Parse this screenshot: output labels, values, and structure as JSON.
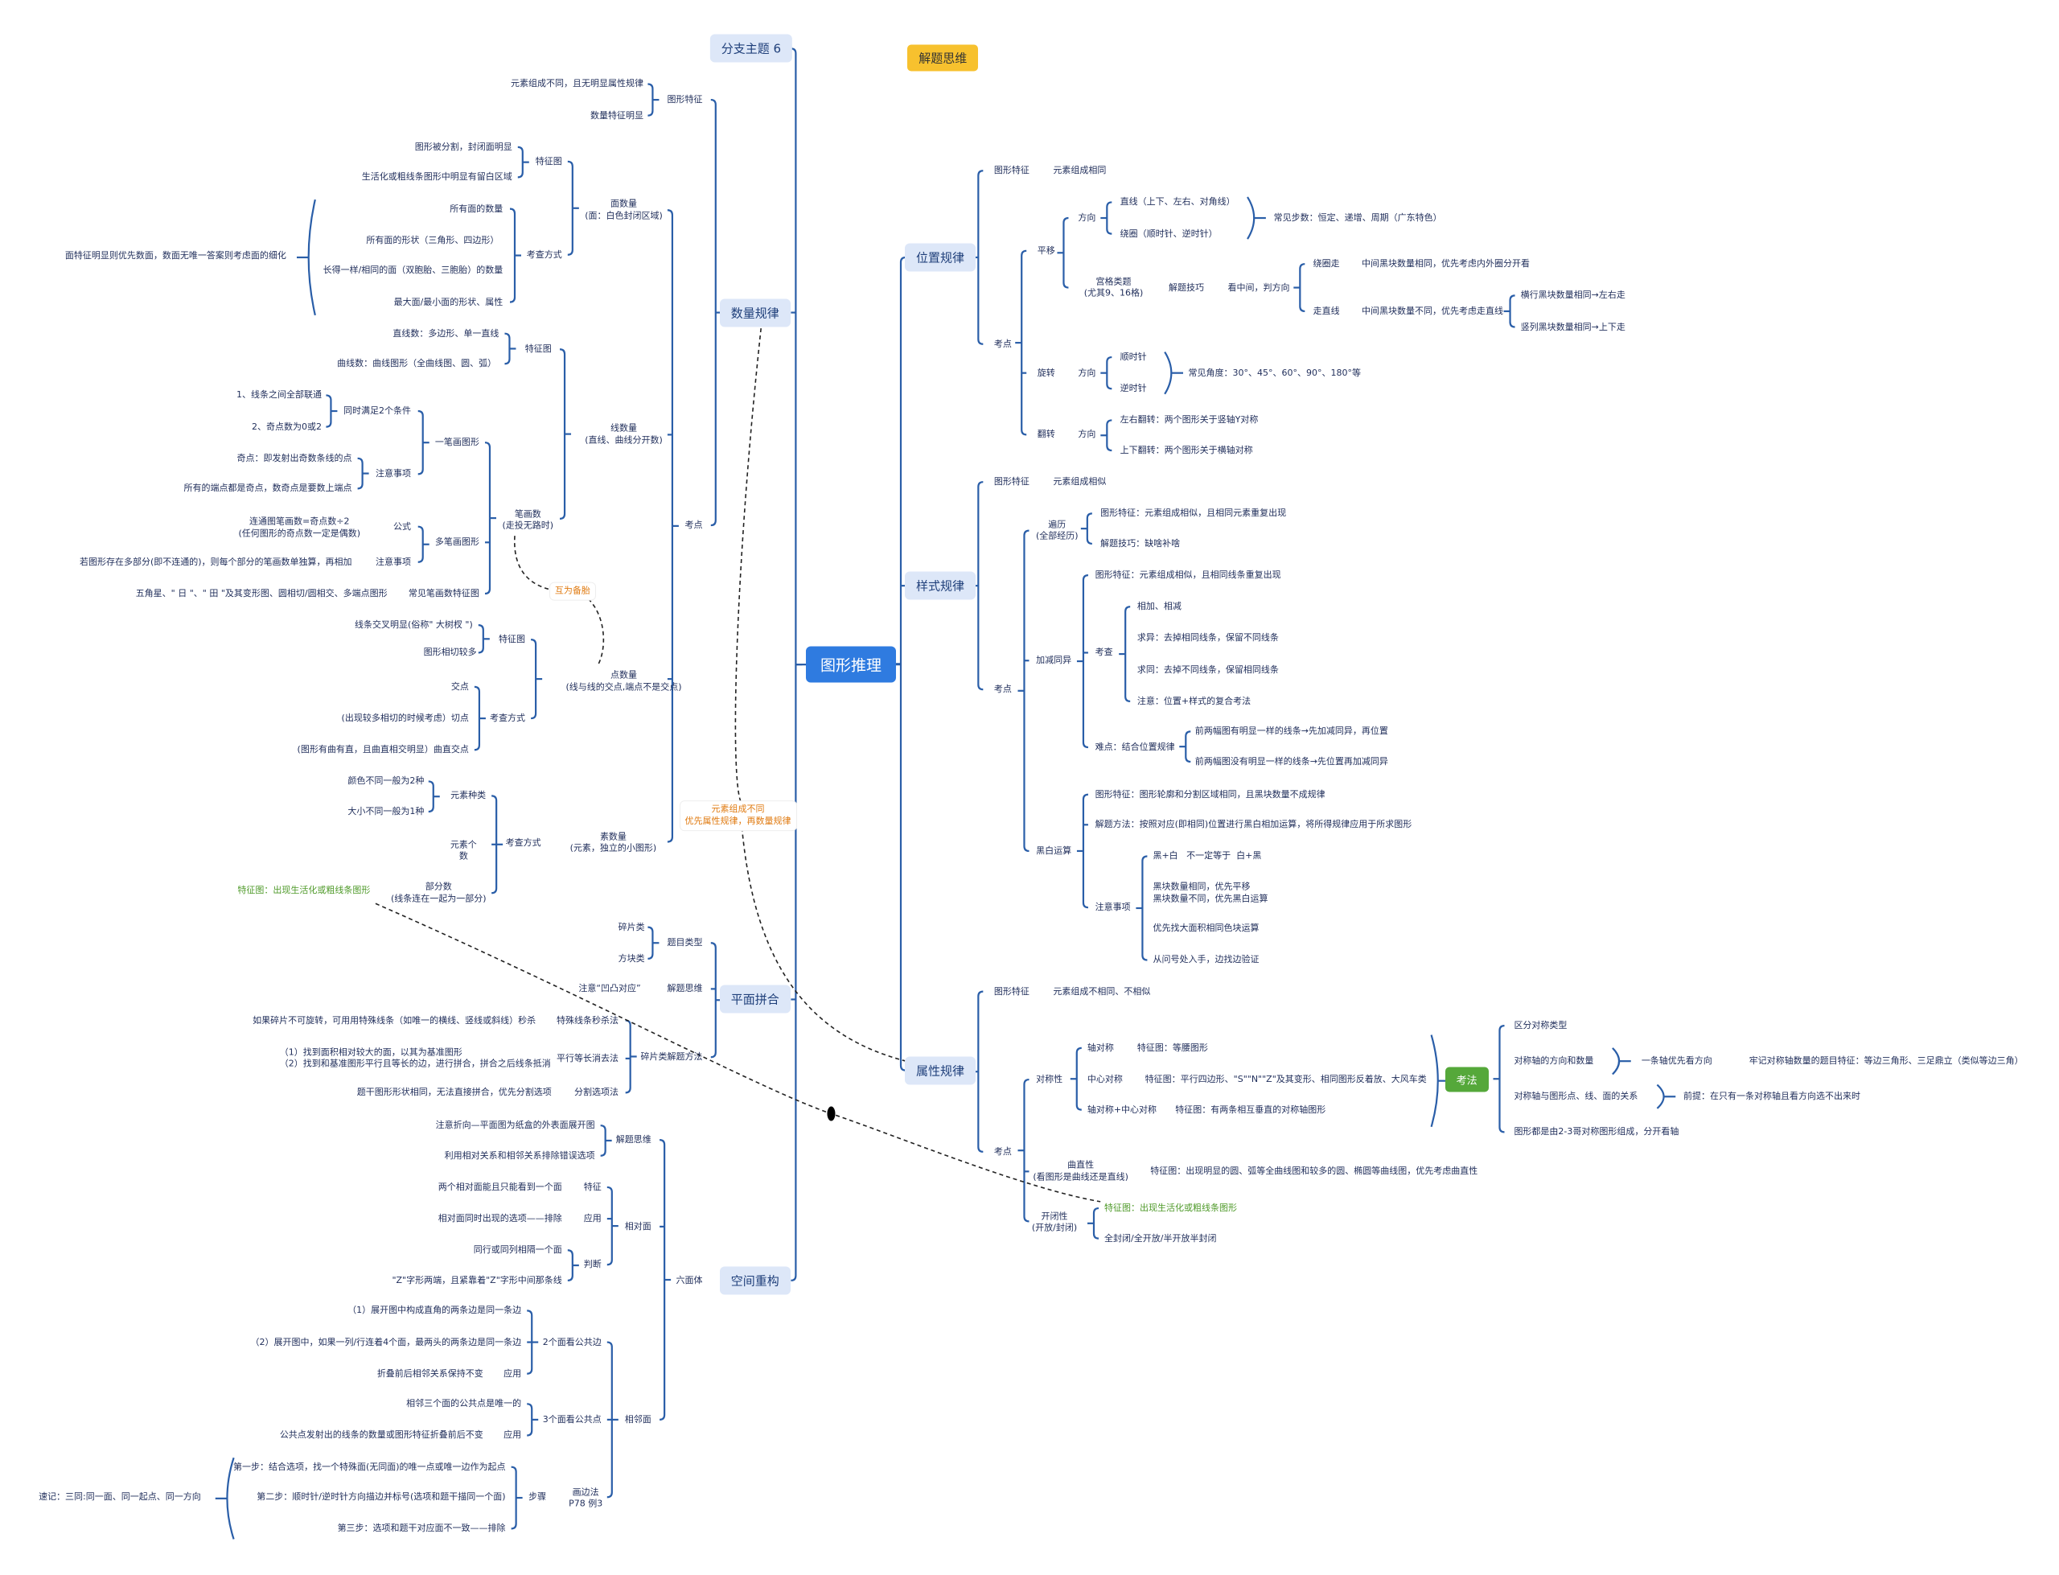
{
  "center": "图形推理",
  "tag": "解题思维",
  "branches": {
    "branch6": "分支主题 6",
    "quantity": "数量规律",
    "plane": "平面拼合",
    "space": "空间重构",
    "position": "位置规律",
    "style": "样式规律",
    "attribute": "属性规律"
  },
  "notes": {
    "backup": "互为备胎",
    "priority": "元素组成不同\n优先属性规律，再数量规律",
    "kaofa": "考法"
  },
  "colors": {
    "line": "#2a5ea8",
    "center": "#2f7be0",
    "branch_bg": "#dde7f8",
    "tag": "#f7c12e",
    "green": "#55a83a",
    "note_text": "#e07b12"
  },
  "quantity": [
    "元素组成不同，且无明显属性规律",
    "数量特征明显",
    "图形特征",
    "图形被分割，封闭面明显",
    "生活化或粗线条图形中明显有留白区域",
    "特征图",
    "所有面的数量",
    "所有面的形状（三角形、四边形）",
    "长得一样/相同的面（双胞胎、三胞胎）的数量",
    "最大面/最小面的形状、属性",
    "考查方式",
    "面数量\n(面：白色封闭区域)",
    "面特征明显则优先数面，数面无唯一答案则考虑面的细化",
    "考点",
    "直线数：多边形、单一直线",
    "曲线数：曲线图形（全曲线图、圆、弧）",
    "特征图",
    "线数量\n(直线、曲线分开数)",
    "1、线条之间全部联通",
    "2、奇点数为0或2",
    "同时满足2个条件",
    "奇点：即发射出奇数条线的点",
    "所有的端点都是奇点，数奇点是要数上端点",
    "注意事项",
    "一笔画图形",
    "连通图笔画数=奇点数÷2\n(任何图形的奇点数一定是偶数)",
    "公式",
    "若图形存在多部分(即不连通的)，则每个部分的笔画数单独算，再相加",
    "注意事项",
    "多笔画图形",
    "五角星、\" 日 \"、\" 田 \"及其变形图、圆相切/圆相交、多端点图形",
    "常见笔画数特征图",
    "笔画数\n(走投无路时)",
    "线条交叉明显(俗称\" 大树杈 \")",
    "图形相切较多",
    "特征图",
    "交点",
    "(出现较多相切的时候考虑）切点",
    "(图形有曲有直，且曲直相交明显）曲直交点",
    "考查方式",
    "点数量\n(线与线的交点,端点不是交点)",
    "颜色不同一般为2种",
    "大小不同一般为1种",
    "元素种类",
    "元素个\n数",
    "考查方式",
    "素数量\n(元素，独立的小图形)",
    "部分数\n(线条连在一起为一部分)",
    "特征图：出现生活化或粗线条图形"
  ],
  "plane": [
    "碎片类",
    "方块类",
    "题目类型",
    "注意“凹凸对应”",
    "解题思维",
    "如果碎片不可旋转，可用用特殊线条（如唯一的横线、竖线或斜线）秒杀",
    "特殊线条秒杀法",
    "（1）找到面积相对较大的面，以其为基准图形\n（2）找到和基准图形平行且等长的边，进行拼合，拼合之后线条抵消",
    "平行等长消去法",
    "题干图形形状相同，无法直接拼合，优先分割选项",
    "分割选项法",
    "碎片类解题方法"
  ],
  "space": [
    "注意折向—平面图为纸盒的外表面展开图",
    "利用相对关系和相邻关系排除错误选项",
    "解题思维",
    "两个相对面能且只能看到一个面",
    "特征",
    "相对面同时出现的选项——排除",
    "应用",
    "同行或同列相隔一个面",
    "\"Z\"字形两端，且紧靠着\"Z\"字形中间那条线",
    "判断",
    "相对面",
    "（1）展开图中构成直角的两条边是同一条边",
    "（2）展开图中，如果一列/行连着4个面，最两头的两条边是同一条边",
    "折叠前后相邻关系保持不变",
    "应用",
    "2个面看公共边",
    "相邻三个面的公共点是唯一的",
    "公共点发射出的线条的数量或图形特征折叠前后不变",
    "应用",
    "3个面看公共点",
    "第一步：结合选项，找一个特殊面(无同面)的唯一点或唯一边作为起点",
    "第二步：顺时针/逆时针方向描边并标号(选项和题干描同一个面)",
    "第三步：选项和题干对应面不一致——排除",
    "步骤",
    "画边法\nP78 例3",
    "速记：三同:同一面、同一起点、同一方向",
    "六面体",
    "相邻面"
  ],
  "position": [
    "图形特征",
    "元素组成相同",
    "考点",
    "平移",
    "方向",
    "直线（上下、左右、对角线）",
    "绕圈（顺时针、逆时针）",
    "常见步数：恒定、递增、周期（广东特色）",
    "宫格类题\n(尤其9、16格)",
    "解题技巧",
    "看中间，判方向",
    "绕圈走",
    "中间黑块数量相同，优先考虑内外圈分开看",
    "走直线",
    "中间黑块数量不同，优先考虑走直线",
    "横行黑块数量相同→左右走",
    "竖列黑块数量相同→上下走",
    "旋转",
    "方向",
    "顺时针",
    "逆时针",
    "常见角度：30°、45°、60°、90°、180°等",
    "翻转",
    "方向",
    "左右翻转：两个图形关于竖轴Y对称",
    "上下翻转：两个图形关于横轴对称"
  ],
  "style": [
    "图形特征",
    "元素组成相似",
    "考点",
    "遍历\n(全部经历)",
    "图形特征：元素组成相似，且相同元素重复出现",
    "解题技巧：缺啥补啥",
    "加减同异",
    "图形特征：元素组成相似，且相同线条重复出现",
    "考查",
    "相加、相减",
    "求异：去掉相同线条，保留不同线条",
    "求同：去掉不同线条，保留相同线条",
    "注意：位置+样式的复合考法",
    "难点：结合位置规律",
    "前两幅图有明显一样的线条→先加减同异，再位置",
    "前两幅图没有明显一样的线条→先位置再加减同异",
    "黑白运算",
    "图形特征：图形轮廓和分割区域相同，且黑块数量不成规律",
    "解题方法：按照对应(即相同)位置进行黑白相加运算，将所得规律应用于所求图形",
    "注意事项",
    "黑+白   不一定等于  白+黑",
    "黑块数量相同，优先平移\n黑块数量不同，优先黑白运算",
    "优先找大面积相同色块运算",
    "从问号处入手，边找边验证"
  ],
  "attribute": [
    "图形特征",
    "元素组成不相同、不相似",
    "考点",
    "对称性",
    "轴对称",
    "特征图：等腰图形",
    "中心对称",
    "特征图：平行四边形、\"S\"\"N\"\"Z\"及其变形、相同图形反着放、大风车类",
    "轴对称+中心对称",
    "特征图：有两条相互垂直的对称轴图形",
    "曲直性\n(看图形是曲线还是直线)",
    "特征图：出现明显的圆、弧等全曲线图和较多的圆、椭圆等曲线图，优先考虑曲直性",
    "开闭性\n(开放/封闭)",
    "特征图：出现生活化或粗线条图形",
    "全封闭/全开放/半开放半封闭",
    "区分对称类型",
    "对称轴的方向和数量",
    "一条轴优先看方向",
    "牢记对称轴数量的题目特征：等边三角形、三足鼎立（类似等边三角）",
    "对称轴与图形点、线、面的关系",
    "前提：在只有一条对称轴且看方向选不出来时",
    "图形都是由2-3哥对称图形组成，分开看轴"
  ]
}
